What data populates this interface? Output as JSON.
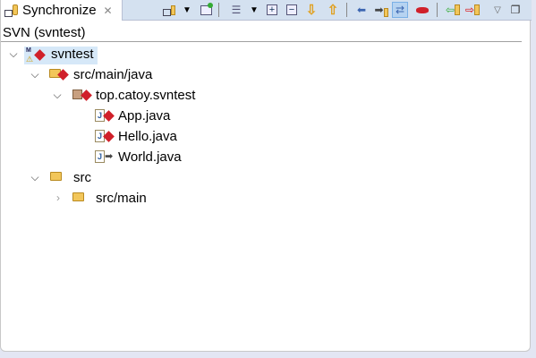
{
  "tab": {
    "title": "Synchronize",
    "icon": "synchronize-icon",
    "close": "✕"
  },
  "toolbar": [
    {
      "name": "synchronize-icon"
    },
    {
      "name": "dropdown-icon"
    },
    {
      "name": "pin-icon"
    },
    {
      "name": "tree-layout-icon"
    },
    {
      "name": "dropdown-icon"
    },
    {
      "name": "expand-all-icon"
    },
    {
      "name": "collapse-all-icon"
    },
    {
      "name": "next-difference-icon"
    },
    {
      "name": "previous-difference-icon"
    },
    {
      "name": "incoming-mode-icon"
    },
    {
      "name": "outgoing-mode-icon"
    },
    {
      "name": "incoming-outgoing-mode-icon"
    },
    {
      "name": "conflicts-mode-icon"
    },
    {
      "name": "update-all-icon"
    },
    {
      "name": "commit-all-icon"
    },
    {
      "name": "view-menu-icon"
    },
    {
      "name": "minimize-icon"
    }
  ],
  "view_title": "SVN (svntest)",
  "tree": [
    {
      "label": "svntest",
      "level": 0,
      "expanded": true
    },
    {
      "label": "src/main/java",
      "level": 1,
      "expanded": true
    },
    {
      "label": "top.catoy.svntest",
      "level": 2,
      "expanded": true
    },
    {
      "label": "App.java",
      "level": 3
    },
    {
      "label": "Hello.java",
      "level": 3
    },
    {
      "label": "World.java",
      "level": 3
    },
    {
      "label": "src",
      "level": 1,
      "expanded": true
    },
    {
      "label": "src/main",
      "level": 2,
      "expanded": false
    }
  ]
}
